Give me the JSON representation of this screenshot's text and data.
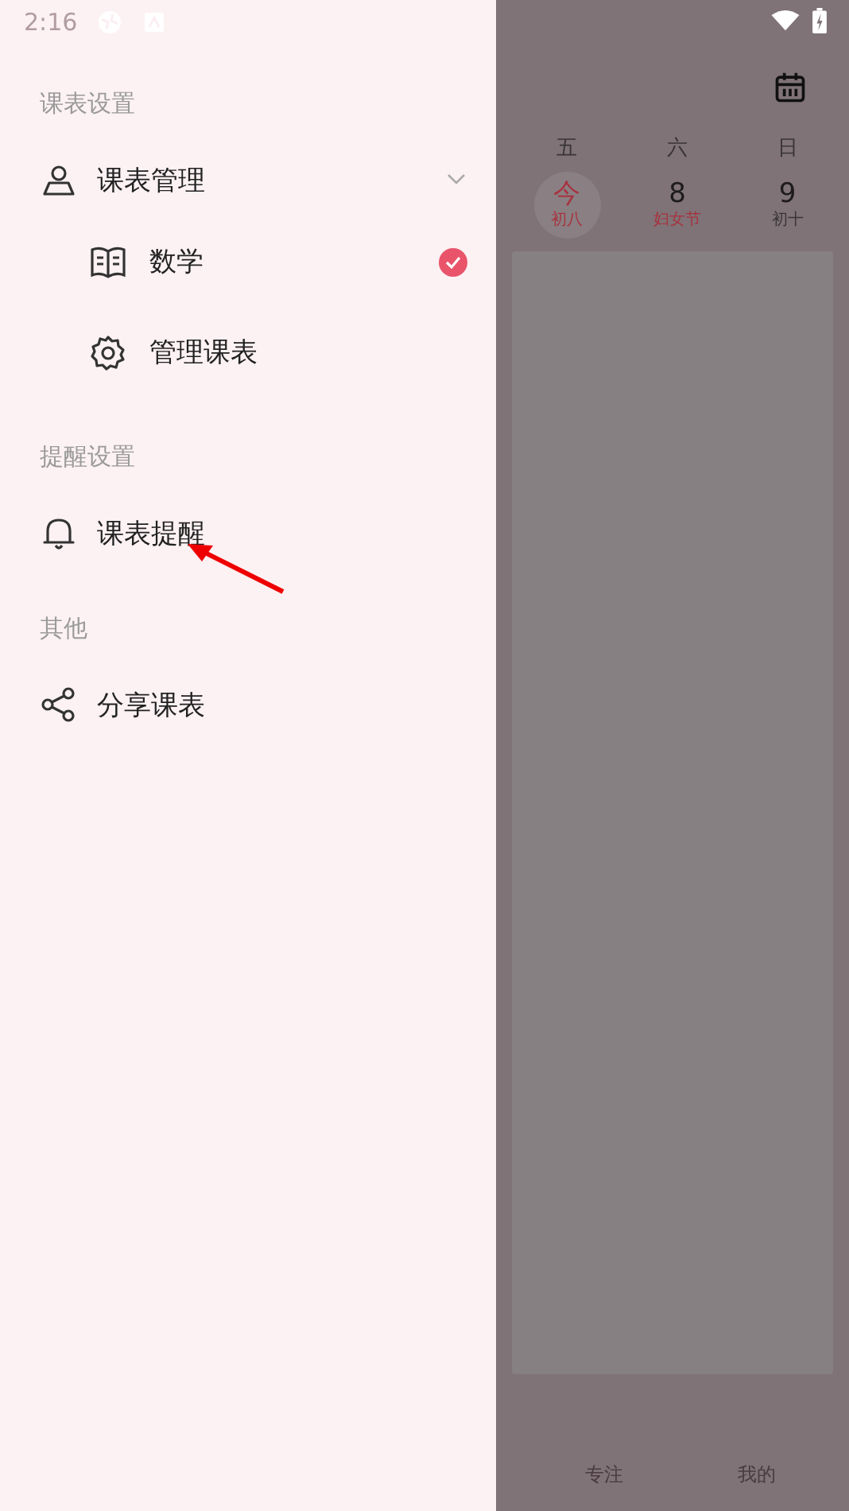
{
  "status_bar": {
    "time": "2:16"
  },
  "drawer": {
    "sections": [
      {
        "title": "课表设置",
        "items": [
          {
            "kind": "profile",
            "label": "课表管理",
            "expanded": true,
            "children": [
              {
                "kind": "book",
                "label": "数学",
                "selected": true
              },
              {
                "kind": "gear",
                "label": "管理课表",
                "selected": false
              }
            ]
          }
        ]
      },
      {
        "title": "提醒设置",
        "items": [
          {
            "kind": "bell",
            "label": "课表提醒"
          }
        ]
      },
      {
        "title": "其他",
        "items": [
          {
            "kind": "share",
            "label": "分享课表"
          }
        ]
      }
    ]
  },
  "week": {
    "days": [
      {
        "weekday": "五",
        "date": "今",
        "sub": "初八",
        "today": true,
        "festival": false
      },
      {
        "weekday": "六",
        "date": "8",
        "sub": "妇女节",
        "today": false,
        "festival": true
      },
      {
        "weekday": "日",
        "date": "9",
        "sub": "初十",
        "today": false,
        "festival": false
      }
    ]
  },
  "bottom_nav": [
    {
      "label": "专注"
    },
    {
      "label": "我的"
    }
  ]
}
